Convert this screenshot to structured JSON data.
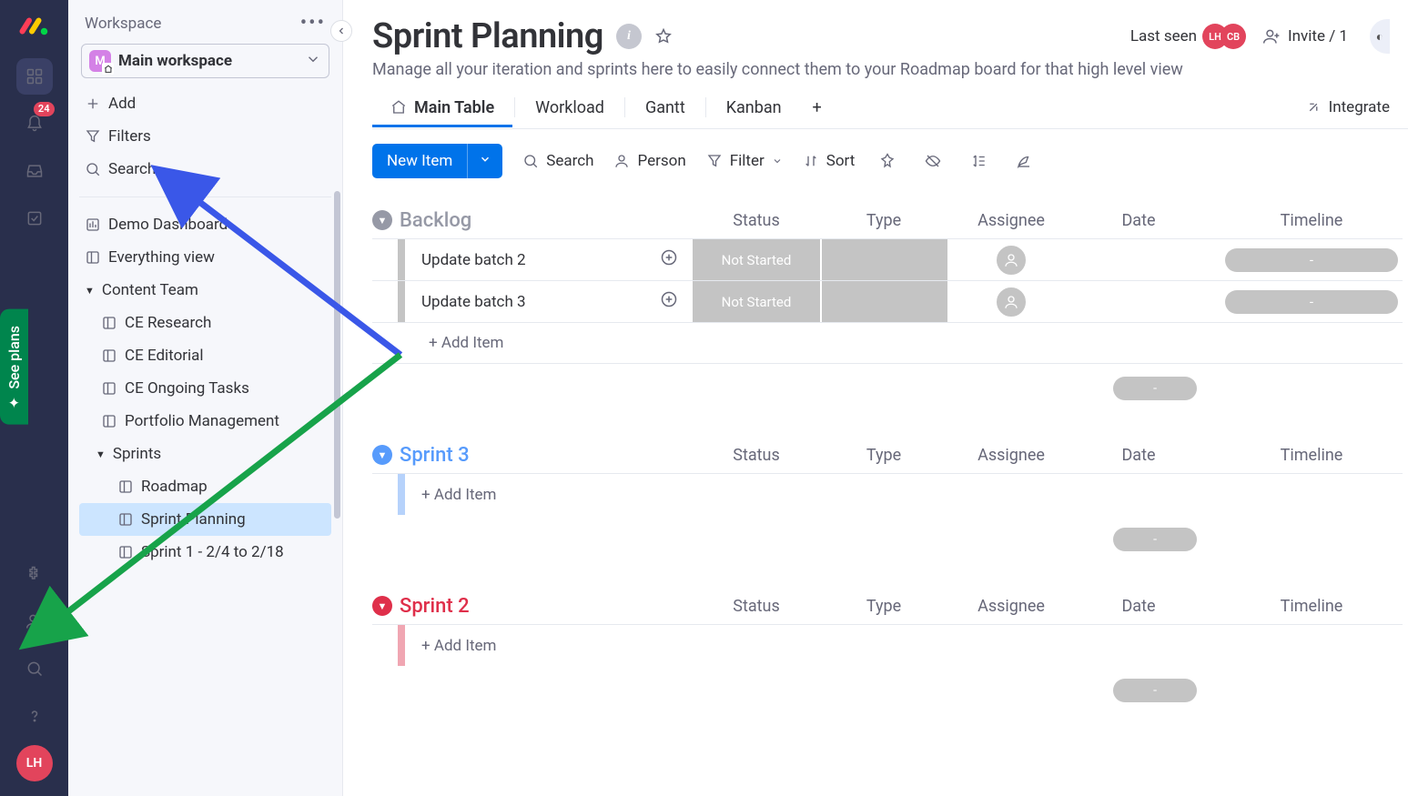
{
  "rail": {
    "notification_count": "24",
    "avatar": "LH"
  },
  "see_plans": "See plans",
  "sidebar": {
    "header": "Workspace",
    "workspace_initial": "M",
    "workspace_name": "Main workspace",
    "add": "Add",
    "filters": "Filters",
    "search": "Search",
    "items": [
      {
        "label": "Demo Dashboard",
        "icon": "dashboard"
      },
      {
        "label": "Everything view",
        "icon": "board"
      }
    ],
    "folder1": "Content Team",
    "folder1_items": [
      "CE Research",
      "CE Editorial",
      "CE Ongoing Tasks",
      "Portfolio Management"
    ],
    "folder2": "Sprints",
    "folder2_items": [
      "Roadmap",
      "Sprint Planning",
      "Sprint 1 - 2/4 to 2/18"
    ]
  },
  "board": {
    "title": "Sprint Planning",
    "subtitle": "Manage all your iteration and sprints here to easily connect them to your Roadmap board for that high level view",
    "last_seen_label": "Last seen",
    "avatars": [
      "LH",
      "CB"
    ],
    "invite_label": "Invite / 1",
    "tabs": [
      "Main Table",
      "Workload",
      "Gantt",
      "Kanban"
    ],
    "integrate_label": "Integrate",
    "new_item": "New Item",
    "toolbar": {
      "search": "Search",
      "person": "Person",
      "filter": "Filter",
      "sort": "Sort"
    },
    "add_item_label": "+ Add Item",
    "columns": [
      "Status",
      "Type",
      "Assignee",
      "Date",
      "Timeline"
    ],
    "groups": [
      {
        "name": "Backlog",
        "color": "#9699a6",
        "collapsed": false,
        "rows": [
          {
            "name": "Update batch 2",
            "status": "Not Started"
          },
          {
            "name": "Update batch 3",
            "status": "Not Started"
          }
        ]
      },
      {
        "name": "Sprint 3",
        "color": "#579bfc",
        "collapsed": false,
        "rows": []
      },
      {
        "name": "Sprint 2",
        "color": "#df2f4a",
        "collapsed": false,
        "rows": []
      }
    ]
  }
}
